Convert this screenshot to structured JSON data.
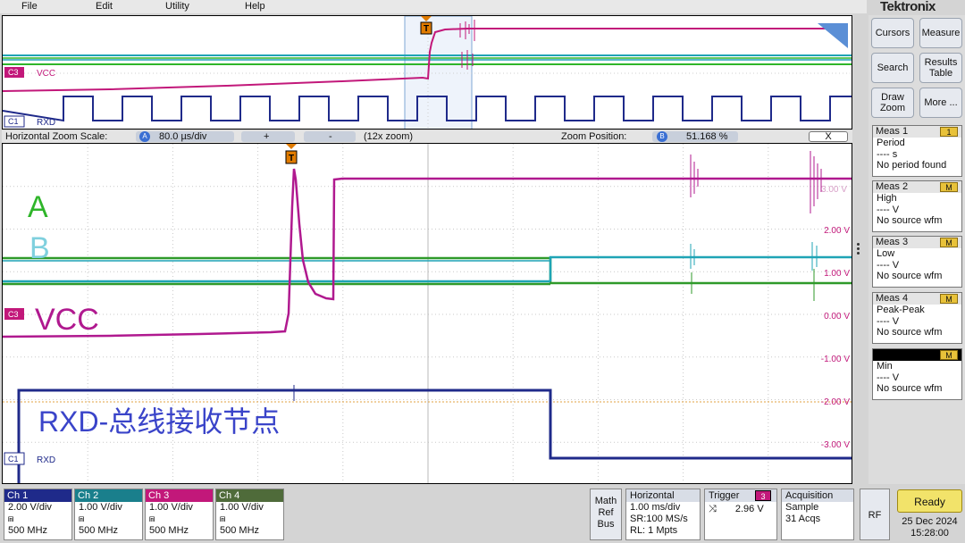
{
  "menu": {
    "file": "File",
    "edit": "Edit",
    "utility": "Utility",
    "help": "Help"
  },
  "brand": "Tektronix",
  "overview": {
    "c3_label": "C3",
    "c3_name": "VCC",
    "c1_label": "C1",
    "c1_name": "RXD",
    "trigger_marker": "T"
  },
  "zoom": {
    "scale_label": "Horizontal Zoom Scale:",
    "scale_badge": "A",
    "scale_value": "80.0 µs/div",
    "plus": "+",
    "minus": "-",
    "zoom_factor": "(12x zoom)",
    "position_label": "Zoom Position:",
    "position_badge": "B",
    "position_value": "51.168 %",
    "close": "X"
  },
  "main": {
    "trigger_marker": "T",
    "label_a": "A",
    "label_b": "B",
    "label_vcc": "VCC",
    "label_rxd": "RXD-总线接收节点",
    "c3_tag": "C3",
    "c1_tag": "C1",
    "c1_name": "RXD",
    "ref_level": "3.00 V",
    "scale_labels": [
      "2.00 V",
      "1.00 V",
      "0.00 V",
      "-1.00 V",
      "-2.00 V",
      "-3.00 V"
    ]
  },
  "side": {
    "cursors": "Cursors",
    "measure": "Measure",
    "search": "Search",
    "results_table_1": "Results",
    "results_table_2": "Table",
    "draw_zoom_1": "Draw",
    "draw_zoom_2": "Zoom",
    "more": "More ..."
  },
  "measurements": [
    {
      "title": "Meas 1",
      "badge": "1",
      "type": "Period",
      "value": "---- s",
      "status": "No period found"
    },
    {
      "title": "Meas 2",
      "badge": "M",
      "type": "High",
      "value": "---- V",
      "status": "No source wfm"
    },
    {
      "title": "Meas 3",
      "badge": "M",
      "type": "Low",
      "value": "---- V",
      "status": "No source wfm"
    },
    {
      "title": "Meas 4",
      "badge": "M",
      "type": "Peak-Peak",
      "value": "---- V",
      "status": "No source wfm"
    },
    {
      "title": "",
      "badge": "M",
      "type": "Min",
      "value": "---- V",
      "status": "No source wfm"
    }
  ],
  "channels": [
    {
      "name": "Ch 1",
      "scale": "2.00 V/div",
      "bw": "500 MHz",
      "color": "#1f2a8a"
    },
    {
      "name": "Ch 2",
      "scale": "1.00 V/div",
      "bw": "500 MHz",
      "color": "#1fa4b5"
    },
    {
      "name": "Ch 3",
      "scale": "1.00 V/div",
      "bw": "500 MHz",
      "color": "#c2187a"
    },
    {
      "name": "Ch 4",
      "scale": "1.00 V/div",
      "bw": "500 MHz",
      "color": "#58a832"
    }
  ],
  "math_ref_bus": {
    "l1": "Math",
    "l2": "Ref",
    "l3": "Bus"
  },
  "horizontal": {
    "title": "Horizontal",
    "scale": "1.00 ms/div",
    "sr": "SR:100 MS/s",
    "rl": "RL: 1 Mpts"
  },
  "trigger": {
    "title": "Trigger",
    "source": "3",
    "level": "2.96 V"
  },
  "acquisition": {
    "title": "Acquisition",
    "mode": "Sample",
    "acqs": "31 Acqs"
  },
  "rf": "RF",
  "status": {
    "state": "Ready",
    "date": "25 Dec 2024",
    "time": "15:28:00"
  },
  "colors": {
    "ch1": "#1f2a8a",
    "ch2": "#1fa4b5",
    "ch3": "#c2187a",
    "ch4": "#2f9a2a",
    "trigger": "#e07b00"
  }
}
